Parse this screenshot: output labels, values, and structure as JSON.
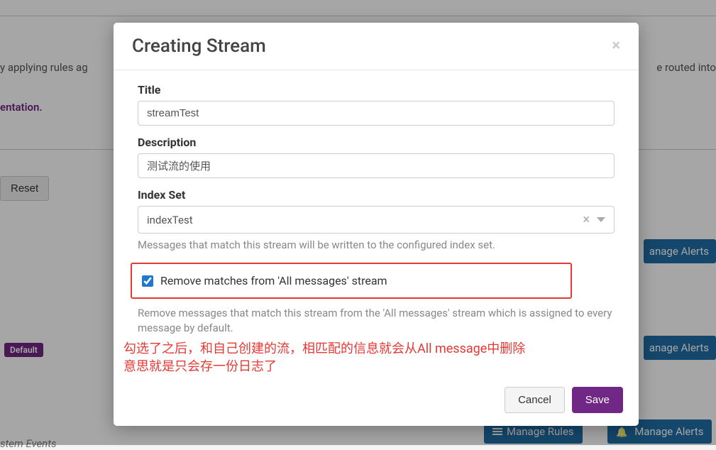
{
  "background": {
    "text_rules": "y applying rules ag",
    "routed_into": "e routed into",
    "doc_link": "entation.",
    "reset_button": "Reset",
    "default_badge": "Default",
    "system_events": "stem Events",
    "manage_alerts": "anage Alerts",
    "manage_rules_full": "Manage Rules",
    "manage_alerts_full": "Manage Alerts"
  },
  "modal": {
    "title": "Creating Stream",
    "fields": {
      "title_label": "Title",
      "title_value": "streamTest",
      "desc_label": "Description",
      "desc_value": "测试流的使用",
      "indexset_label": "Index Set",
      "indexset_value": "indexTest",
      "indexset_help": "Messages that match this stream will be written to the configured index set.",
      "remove_label": "Remove matches from 'All messages' stream",
      "remove_help": "Remove messages that match this stream from the 'All messages' stream which is assigned to every message by default.",
      "remove_checked": true
    },
    "annotation_line1": "勾选了之后，和自己创建的流，相匹配的信息就会从All message中删除",
    "annotation_line2": "意思就是只会存一份日志了",
    "cancel": "Cancel",
    "save": "Save"
  }
}
